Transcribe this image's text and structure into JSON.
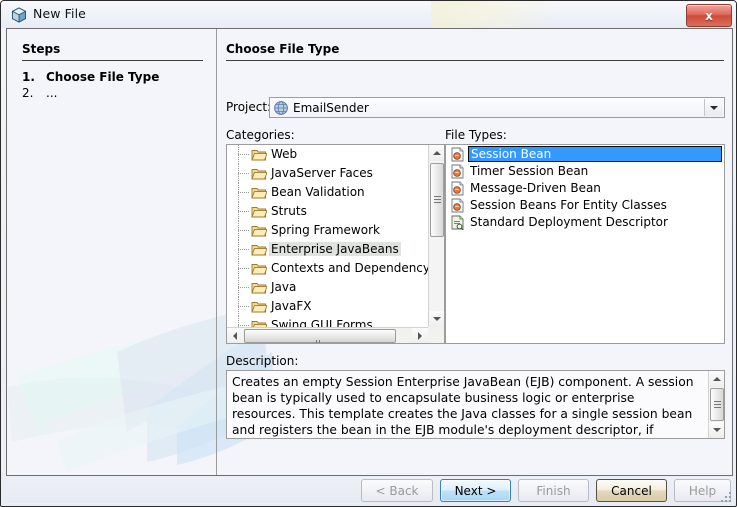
{
  "window": {
    "title": "New File",
    "icon": "cube-icon",
    "close_label": "x"
  },
  "steps": {
    "heading": "Steps",
    "items": [
      {
        "number": "1.",
        "label": "Choose File Type",
        "active": true
      },
      {
        "number": "2.",
        "label": "...",
        "active": false
      }
    ]
  },
  "main": {
    "heading": "Choose File Type",
    "project": {
      "label": "Project:",
      "value": "EmailSender",
      "icon": "globe-icon"
    },
    "categories": {
      "label": "Categories:",
      "selected": "Enterprise JavaBeans",
      "items": [
        "Web",
        "JavaServer Faces",
        "Bean Validation",
        "Struts",
        "Spring Framework",
        "Enterprise JavaBeans",
        "Contexts and Dependency Inje",
        "Java",
        "JavaFX",
        "Swing GUI Forms"
      ]
    },
    "file_types": {
      "label": "File Types:",
      "selected": "Session Bean",
      "items": [
        {
          "label": "Session Bean",
          "icon": "bean-icon"
        },
        {
          "label": "Timer Session Bean",
          "icon": "bean-icon"
        },
        {
          "label": "Message-Driven Bean",
          "icon": "bean-icon"
        },
        {
          "label": "Session Beans For Entity Classes",
          "icon": "bean-icon"
        },
        {
          "label": "Standard Deployment Descriptor",
          "icon": "descriptor-icon"
        }
      ]
    },
    "description": {
      "label": "Description:",
      "text": "Creates an empty Session Enterprise JavaBean (EJB) component. A session bean is typically used to encapsulate business logic or enterprise resources. This template creates the Java classes for a single session bean and registers the bean in the EJB module's deployment descriptor, if required."
    }
  },
  "buttons": {
    "back": "< Back",
    "next": "Next >",
    "finish": "Finish",
    "cancel": "Cancel",
    "help": "Help"
  },
  "colors": {
    "selection_blue": "#3399ff",
    "category_selection": "#dce4dd",
    "close_red": "#cf4b39",
    "default_button_blue": "#a7d8f2",
    "hover_button_tan": "#d9cba9"
  }
}
